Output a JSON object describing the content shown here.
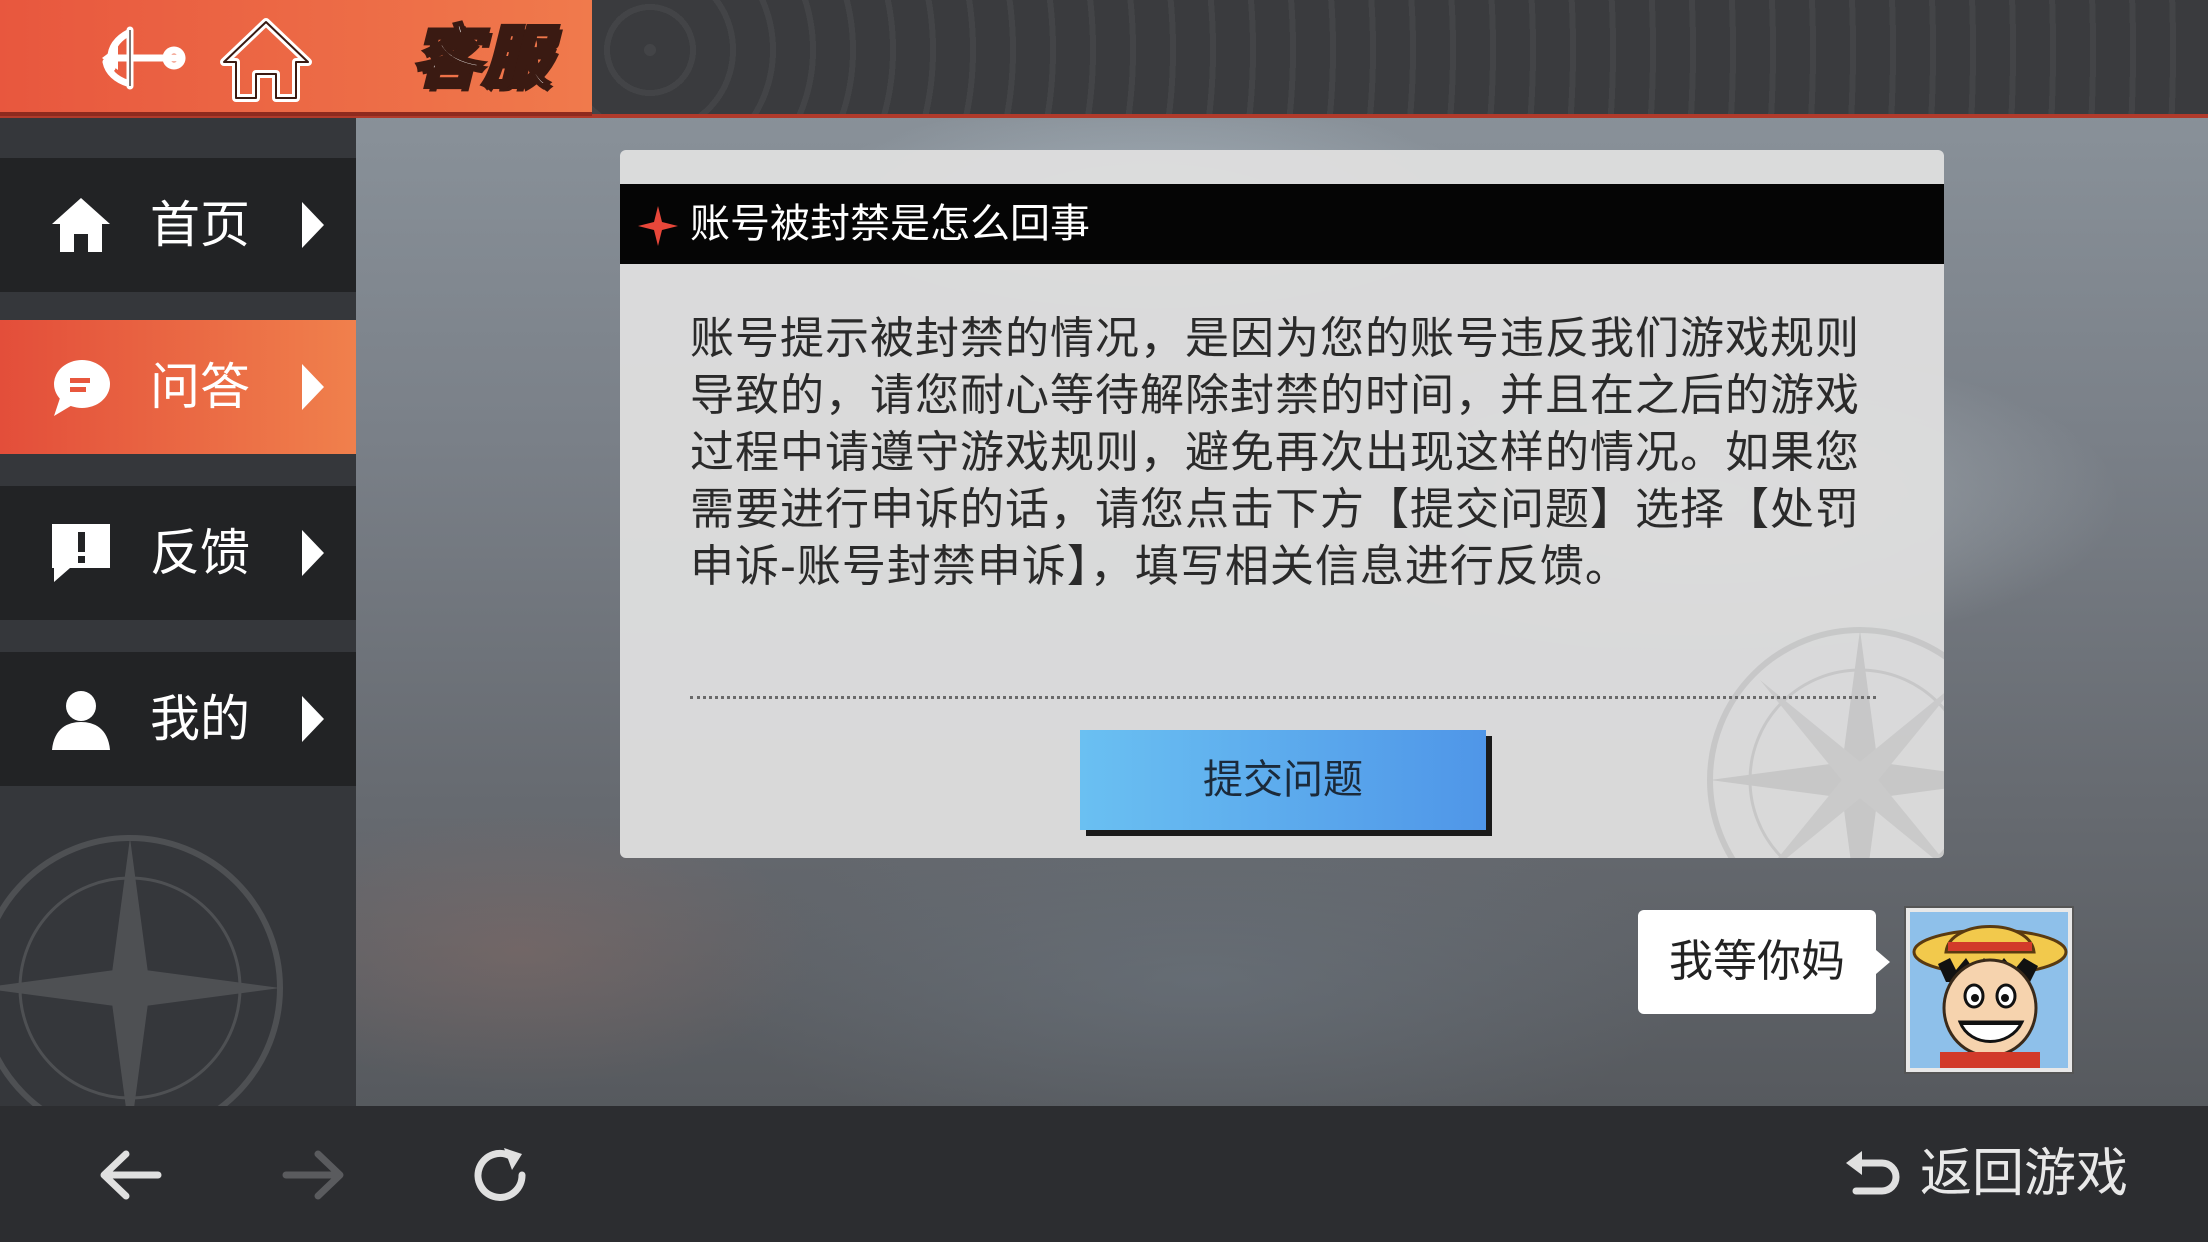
{
  "header": {
    "title": "客服"
  },
  "sidebar": {
    "items": [
      {
        "label": "首页",
        "icon": "home-icon"
      },
      {
        "label": "问答",
        "icon": "chat-icon"
      },
      {
        "label": "反馈",
        "icon": "feedback-icon"
      },
      {
        "label": "我的",
        "icon": "user-icon"
      }
    ],
    "active_index": 1
  },
  "card": {
    "title": "账号被封禁是怎么回事",
    "body": "账号提示被封禁的情况，是因为您的账号违反我们游戏规则导致的，请您耐心等待解除封禁的时间，并且在之后的游戏过程中请遵守游戏规则，避免再次出现这样的情况。如果您需要进行申诉的话，请您点击下方【提交问题】选择【处罚申诉-账号封禁申诉】，填写相关信息进行反馈。",
    "submit_label": "提交问题"
  },
  "chat": {
    "message": "我等你妈"
  },
  "footer": {
    "return_label": "返回游戏"
  },
  "colors": {
    "accent": "#e8573e",
    "accent_light": "#f07a4c",
    "button_blue": "#4f96e8"
  }
}
